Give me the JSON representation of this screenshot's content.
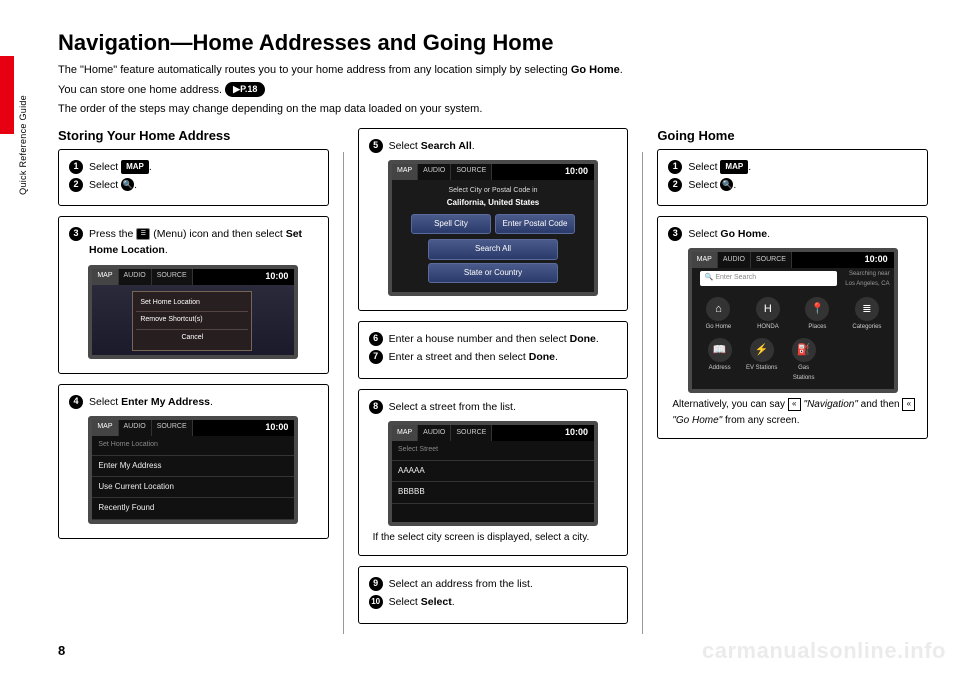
{
  "side_label": "Quick Reference Guide",
  "page_number": "8",
  "watermark": "carmanualsonline.info",
  "title": "Navigation—Home Addresses and Going Home",
  "intro": {
    "l1a": "The \"Home\" feature automatically routes you to your home address from any location simply by selecting ",
    "l1b": "Go Home",
    "l1c": ".",
    "l2": "You can store one home address.",
    "pref": "P.18",
    "l3": "The order of the steps may change depending on the map data loaded on your system."
  },
  "colA": {
    "heading": "Storing Your Home Address",
    "box1": {
      "s1a": "Select ",
      "s1btn": "MAP",
      "s1b": ".",
      "s2a": "Select ",
      "s2icon": "🔍",
      "s2b": "."
    },
    "box2": {
      "s3a": "Press the ",
      "s3icon": "☰",
      "s3b": " (Menu) icon and then select ",
      "s3bold": "Set Home Location",
      "s3c": ".",
      "screen": {
        "tabs": [
          "MAP",
          "AUDIO",
          "SOURCE"
        ],
        "time": "10:00",
        "popup": [
          "Set Home Location",
          "Remove Shortcut(s)",
          "Cancel"
        ]
      }
    },
    "box3": {
      "s4a": "Select ",
      "s4bold": "Enter My Address",
      "s4c": ".",
      "screen": {
        "tabs": [
          "MAP",
          "AUDIO",
          "SOURCE"
        ],
        "time": "10:00",
        "hdr": "Set Home Location",
        "items": [
          "Enter My Address",
          "Use Current Location",
          "Recently Found"
        ]
      }
    }
  },
  "colB": {
    "box1": {
      "s5a": "Select ",
      "s5bold": "Search All",
      "s5c": ".",
      "screen": {
        "tabs": [
          "MAP",
          "AUDIO",
          "SOURCE"
        ],
        "time": "10:00",
        "hdr1": "Select City or Postal Code in",
        "hdr2": "California, United States",
        "pills_row": [
          "Spell City",
          "Enter Postal Code"
        ],
        "pill1": "Search All",
        "pill2": "State or Country"
      }
    },
    "box2": {
      "s6a": "Enter a house number and then select ",
      "s6bold": "Done",
      "s6c": ".",
      "s7a": "Enter a street and then select ",
      "s7bold": "Done",
      "s7c": "."
    },
    "box3": {
      "s8": "Select a street from the list.",
      "screen": {
        "tabs": [
          "MAP",
          "AUDIO",
          "SOURCE"
        ],
        "time": "10:00",
        "hdr": "Select Street",
        "items": [
          "AAAAA",
          "BBBBB"
        ]
      },
      "note": "If the select city screen is displayed, select a city."
    },
    "box4": {
      "s9": "Select an address from the list.",
      "s10a": "Select ",
      "s10bold": "Select",
      "s10c": "."
    }
  },
  "colC": {
    "heading": "Going Home",
    "box1": {
      "s1a": "Select ",
      "s1btn": "MAP",
      "s1b": ".",
      "s2a": "Select ",
      "s2icon": "🔍",
      "s2b": "."
    },
    "box2": {
      "s3a": "Select ",
      "s3bold": "Go Home",
      "s3c": ".",
      "screen": {
        "tabs": [
          "MAP",
          "AUDIO",
          "SOURCE"
        ],
        "time": "10:00",
        "search": "🔍 Enter Search",
        "search_sub1": "Searching near",
        "search_sub2": "Los Angeles, CA",
        "icons": [
          {
            "g": "⌂",
            "l": "Go Home"
          },
          {
            "g": "H",
            "l": "HONDA"
          },
          {
            "g": "📍",
            "l": "Places"
          },
          {
            "g": "≣",
            "l": "Categories"
          }
        ],
        "icons2": [
          {
            "g": "📖",
            "l": "Address"
          },
          {
            "g": "⚡",
            "l": "EV Stations"
          },
          {
            "g": "⛽",
            "l": "Gas Stations"
          }
        ]
      },
      "alt1": "Alternatively, you can say ",
      "alt2": "\"Navigation\"",
      "alt3": " and then ",
      "alt4": "\"Go Home\"",
      "alt5": " from any screen."
    }
  }
}
